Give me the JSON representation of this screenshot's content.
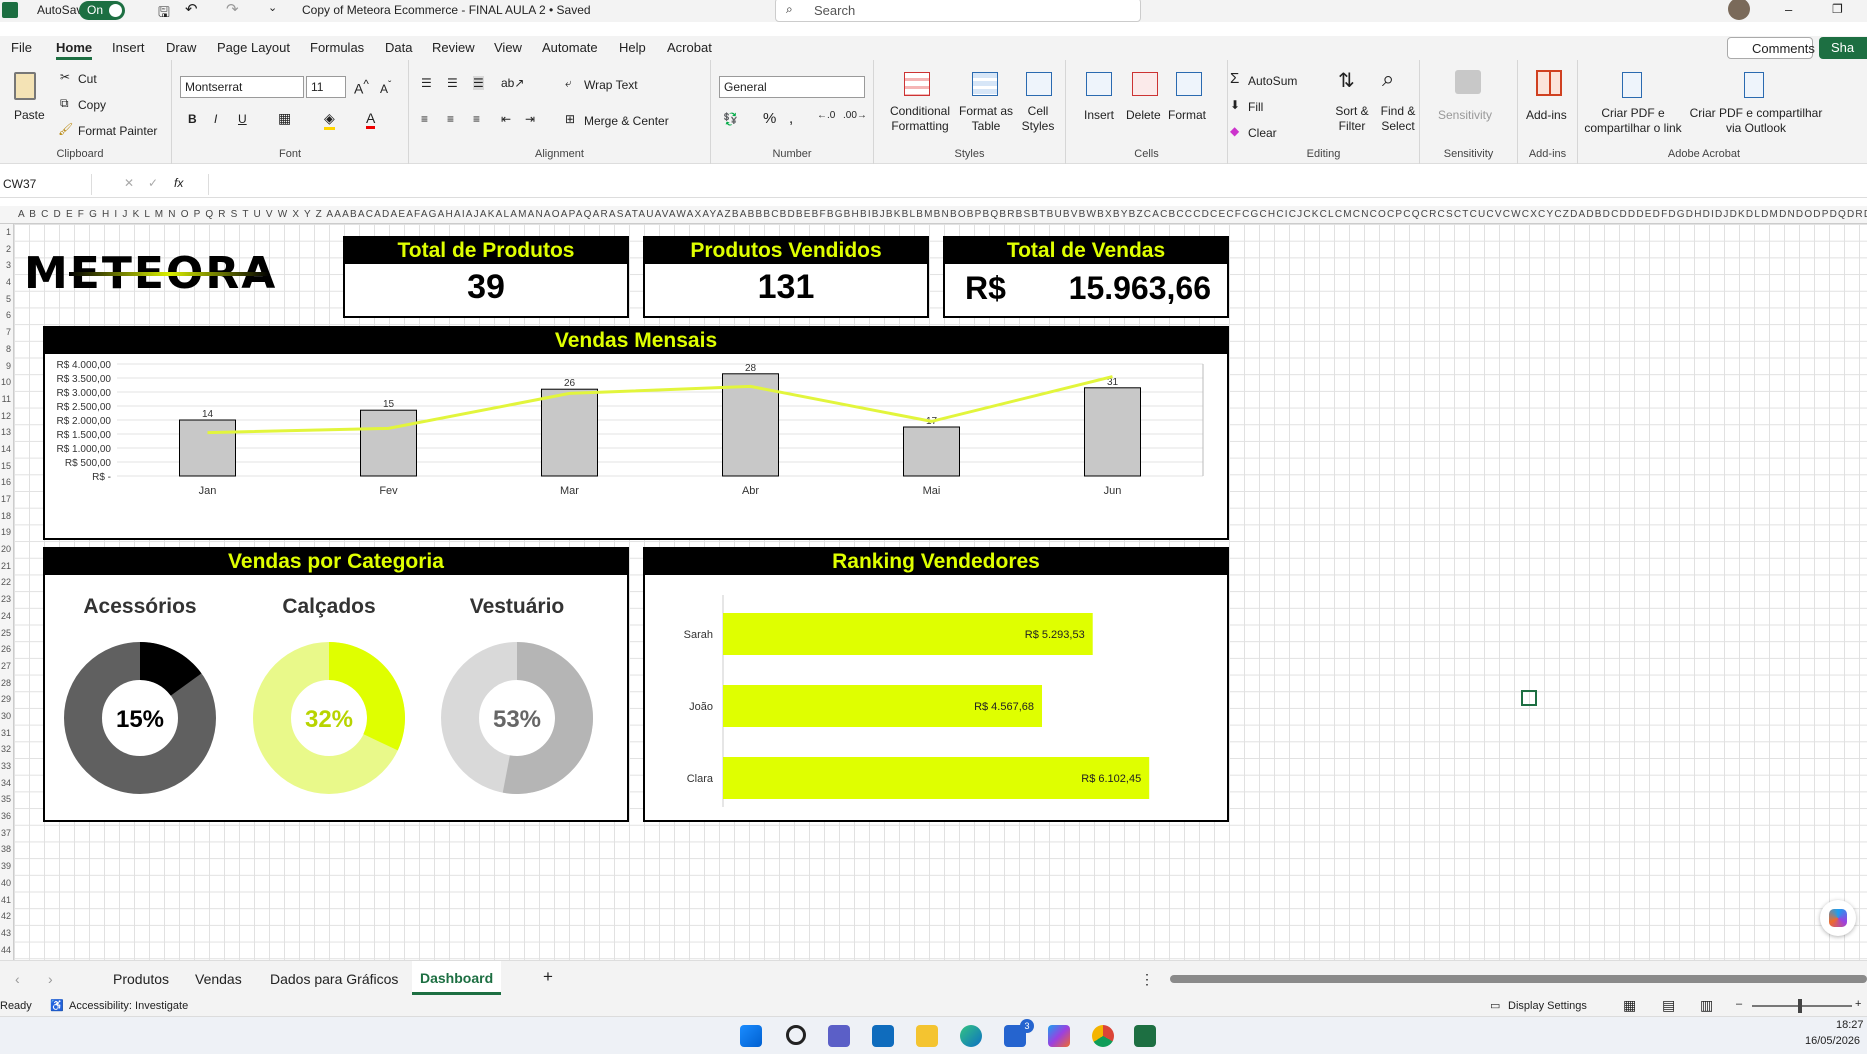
{
  "titlebar": {
    "autosave_label": "AutoSave",
    "autosave_state": "On",
    "doc_title": "Copy of Meteora Ecommerce - FINAL AULA 2 • Saved",
    "search_placeholder": "Search"
  },
  "menu": {
    "items": [
      "File",
      "Home",
      "Insert",
      "Draw",
      "Page Layout",
      "Formulas",
      "Data",
      "Review",
      "View",
      "Automate",
      "Help",
      "Acrobat"
    ],
    "active": "Home",
    "comments_label": "Comments",
    "share_label": "Sha"
  },
  "ribbon": {
    "clipboard": {
      "paste": "Paste",
      "cut": "Cut",
      "copy": "Copy",
      "format_painter": "Format Painter",
      "label": "Clipboard"
    },
    "font": {
      "family": "Montserrat",
      "size": "11",
      "label": "Font",
      "bold": "B",
      "italic": "I",
      "underline": "U"
    },
    "alignment": {
      "wrap": "Wrap Text",
      "merge": "Merge & Center",
      "label": "Alignment"
    },
    "number": {
      "format": "General",
      "label": "Number",
      "percent": "%"
    },
    "styles": {
      "conditional": "Conditional Formatting",
      "format_table": "Format as Table",
      "cell_styles": "Cell Styles",
      "label": "Styles"
    },
    "cells": {
      "insert": "Insert",
      "delete": "Delete",
      "format": "Format",
      "label": "Cells"
    },
    "editing": {
      "autosum": "AutoSum",
      "fill": "Fill",
      "clear": "Clear",
      "sort": "Sort & Filter",
      "find": "Find & Select",
      "label": "Editing"
    },
    "sensitivity": {
      "btn": "Sensitivity",
      "label": "Sensitivity"
    },
    "addins": {
      "btn": "Add-ins",
      "label": "Add-ins"
    },
    "acrobat": {
      "pdf_link": "Criar PDF e compartilhar o link",
      "pdf_outlook": "Criar PDF e compartilhar via Outlook",
      "label": "Adobe Acrobat"
    }
  },
  "formula": {
    "namebox": "CW37",
    "fx": "fx",
    "content": ""
  },
  "columns": "A B C D E F G H I J K L M N O P Q R S T U V W X Y Z AAABACADAEAFAGAHAIAJAKALAMANAOAPAQARASATAUAVAWAXAYAZBABBBCBDBEBFBGBHBIBJBKBLBMBNBOBPBQBRBSBTBUBVBWBXBYBZCACBCCCDCECFCGCHCICJCKCLCMCNCOCPCQCRCSCTCUCVCWCXCYCZDADBDCDDDEDFDGDHDIDJDKDLDMDNDODPDQDRDSDT",
  "dashboard": {
    "logo": "METEORA",
    "kpis": [
      {
        "title": "Total de Produtos",
        "value": "39"
      },
      {
        "title": "Produtos Vendidos",
        "value": "131"
      },
      {
        "title": "Total de Vendas",
        "currency": "R$",
        "value": "15.963,66"
      }
    ],
    "monthly_title": "Vendas Mensais",
    "category_title": "Vendas por Categoria",
    "ranking_title": "Ranking Vendedores"
  },
  "chart_data": [
    {
      "type": "bar",
      "title": "Vendas Mensais",
      "categories": [
        "Jan",
        "Fev",
        "Mar",
        "Abr",
        "Mai",
        "Jun"
      ],
      "ylim": [
        0,
        4000
      ],
      "y_ticks": [
        "R$ -",
        "R$ 500,00",
        "R$ 1.000,00",
        "R$ 1.500,00",
        "R$ 2.000,00",
        "R$ 2.500,00",
        "R$ 3.000,00",
        "R$ 3.500,00",
        "R$ 4.000,00"
      ],
      "series": [
        {
          "kind": "bar",
          "values": [
            2000,
            2350,
            3100,
            3650,
            1750,
            3150
          ],
          "labels": [
            "14",
            "15",
            "26",
            "28",
            "17",
            "31"
          ],
          "color": "#c8c8c8"
        },
        {
          "kind": "line",
          "values": [
            1550,
            1700,
            2950,
            3200,
            1950,
            3550
          ],
          "color": "#e2f53c"
        }
      ],
      "grid": true
    },
    {
      "type": "pie",
      "title": "Vendas por Categoria",
      "slices": [
        {
          "name": "Acessórios",
          "value": 15,
          "label": "15%",
          "color": "#000000",
          "rest_color": "#606060",
          "label_color": "#000000"
        },
        {
          "name": "Calçados",
          "value": 32,
          "label": "32%",
          "color": "#dfff00",
          "rest_color": "#e9f98a",
          "label_color": "#b8d400"
        },
        {
          "name": "Vestuário",
          "value": 53,
          "label": "53%",
          "color": "#b5b5b5",
          "rest_color": "#d9d9d9",
          "label_color": "#666666"
        }
      ]
    },
    {
      "type": "bar",
      "orientation": "horizontal",
      "title": "Ranking Vendedores",
      "categories": [
        "Sarah",
        "João",
        "Clara"
      ],
      "values": [
        5293.53,
        4567.68,
        6102.45
      ],
      "labels": [
        "R$ 5.293,53",
        "R$ 4.567,68",
        "R$ 6.102,45"
      ],
      "color": "#dfff00"
    }
  ],
  "tabs": {
    "items": [
      "Produtos",
      "Vendas",
      "Dados para Gráficos",
      "Dashboard"
    ],
    "active": "Dashboard",
    "add": "+"
  },
  "status": {
    "ready": "Ready",
    "accessibility": "Accessibility: Investigate",
    "display": "Display Settings"
  },
  "taskbar": {
    "time": "18:27",
    "date": "16/05/2026",
    "badge": "3"
  }
}
